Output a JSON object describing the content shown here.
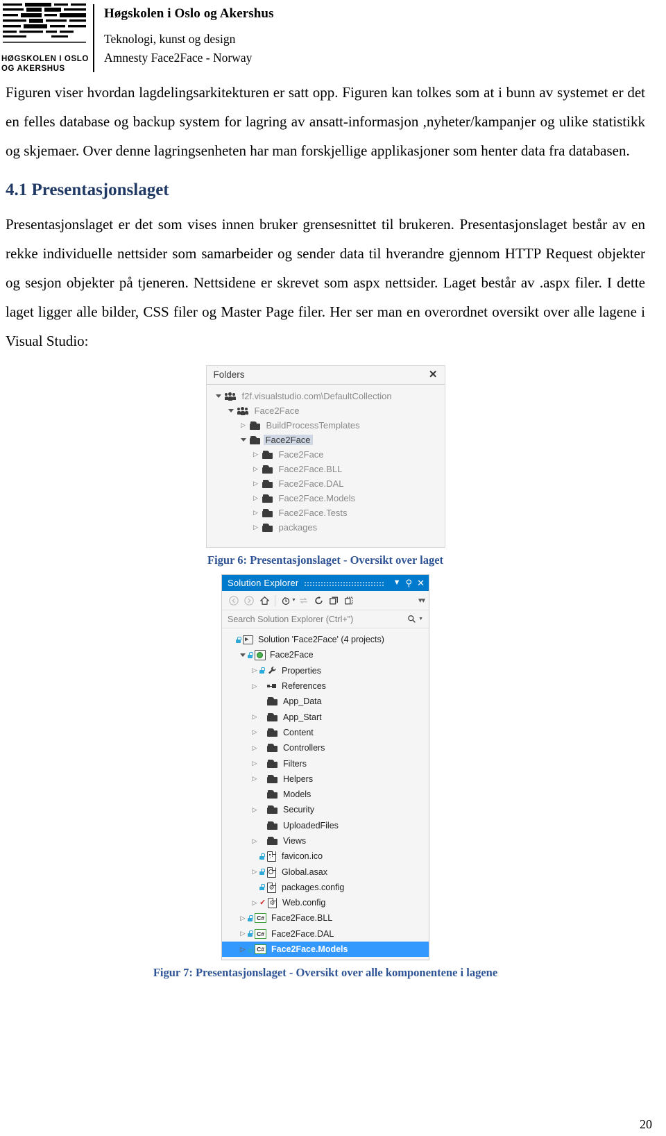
{
  "header": {
    "logo_caption_line1": "HØGSKOLEN I OSLO",
    "logo_caption_line2": "OG AKERSHUS",
    "org_name": "Høgskolen i Oslo og Akershus",
    "faculty": "Teknologi, kunst og design",
    "project": "Amnesty Face2Face - Norway"
  },
  "body": {
    "paragraph_1": "Figuren viser hvordan lagdelingsarkitekturen er satt opp. Figuren kan tolkes som at i bunn av systemet er det en felles database og backup system for lagring av ansatt-informasjon ,nyheter/kampanjer og ulike statistikk og skjemaer. Over denne lagringsenheten har man forskjellige applikasjoner som henter data fra databasen.",
    "heading_4_1": "4.1 Presentasjonslaget",
    "paragraph_2": "Presentasjonslaget er det som vises innen bruker grensesnittet til brukeren. Presentasjonslaget består av en rekke individuelle nettsider som samarbeider og sender data til hverandre gjennom HTTP Request objekter og sesjon objekter på tjeneren. Nettsidene er skrevet som aspx nettsider. Laget består av .aspx filer. I dette laget ligger alle bilder, CSS filer og Master Page filer. Her ser man en overordnet oversikt over alle lagene i Visual Studio:"
  },
  "figure6": {
    "caption": "Figur 6: Presentasjonslaget - Oversikt over laget",
    "panel_title": "Folders",
    "close_label": "✕",
    "tree": [
      {
        "label": "f2f.visualstudio.com\\DefaultCollection",
        "indent": 0,
        "expander": "down",
        "icon": "team-icon",
        "selected": false
      },
      {
        "label": "Face2Face",
        "indent": 1,
        "expander": "down",
        "icon": "team-icon",
        "selected": false
      },
      {
        "label": "BuildProcessTemplates",
        "indent": 2,
        "expander": "right",
        "icon": "folder-icon",
        "selected": false
      },
      {
        "label": "Face2Face",
        "indent": 2,
        "expander": "down",
        "icon": "folder-icon",
        "selected": true
      },
      {
        "label": "Face2Face",
        "indent": 3,
        "expander": "right",
        "icon": "folder-icon",
        "selected": false
      },
      {
        "label": "Face2Face.BLL",
        "indent": 3,
        "expander": "right",
        "icon": "folder-icon",
        "selected": false
      },
      {
        "label": "Face2Face.DAL",
        "indent": 3,
        "expander": "right",
        "icon": "folder-icon",
        "selected": false
      },
      {
        "label": "Face2Face.Models",
        "indent": 3,
        "expander": "right",
        "icon": "folder-icon",
        "selected": false
      },
      {
        "label": "Face2Face.Tests",
        "indent": 3,
        "expander": "right",
        "icon": "folder-icon",
        "selected": false
      },
      {
        "label": "packages",
        "indent": 3,
        "expander": "right",
        "icon": "folder-icon",
        "selected": false
      }
    ]
  },
  "figure7": {
    "caption": "Figur 7: Presentasjonslaget - Oversikt over alle komponentene i lagene",
    "panel_title": "Solution Explorer",
    "titlebar_buttons": [
      "dropdown-icon",
      "pin-icon",
      "close-icon"
    ],
    "toolbar_icons": [
      "back-arrow-icon",
      "forward-arrow-icon",
      "home-icon",
      "pending-changes-icon",
      "sync-icon",
      "refresh-icon",
      "collapse-all-icon",
      "show-all-files-icon"
    ],
    "search_placeholder": "Search Solution Explorer (Ctrl+\")",
    "search_value": "",
    "accent_color": "#007acc",
    "selection_color": "#3399ff",
    "tree": [
      {
        "label": "Solution 'Face2Face' (4 projects)",
        "indent": 0,
        "expander": "none",
        "badge": "lock",
        "icon": "solution-icon",
        "selected": false
      },
      {
        "label": "Face2Face",
        "indent": 1,
        "expander": "down",
        "badge": "lock",
        "icon": "web-project-icon",
        "selected": false
      },
      {
        "label": "Properties",
        "indent": 2,
        "expander": "right",
        "badge": "lock",
        "icon": "wrench-icon",
        "selected": false
      },
      {
        "label": "References",
        "indent": 2,
        "expander": "right",
        "badge": "none",
        "icon": "references-icon",
        "selected": false
      },
      {
        "label": "App_Data",
        "indent": 2,
        "expander": "none",
        "badge": "none",
        "icon": "folder-icon",
        "selected": false
      },
      {
        "label": "App_Start",
        "indent": 2,
        "expander": "right",
        "badge": "none",
        "icon": "folder-icon",
        "selected": false
      },
      {
        "label": "Content",
        "indent": 2,
        "expander": "right",
        "badge": "none",
        "icon": "folder-icon",
        "selected": false
      },
      {
        "label": "Controllers",
        "indent": 2,
        "expander": "right",
        "badge": "none",
        "icon": "folder-icon",
        "selected": false
      },
      {
        "label": "Filters",
        "indent": 2,
        "expander": "right",
        "badge": "none",
        "icon": "folder-icon",
        "selected": false
      },
      {
        "label": "Helpers",
        "indent": 2,
        "expander": "right",
        "badge": "none",
        "icon": "folder-icon",
        "selected": false
      },
      {
        "label": "Models",
        "indent": 2,
        "expander": "none",
        "badge": "none",
        "icon": "folder-icon",
        "selected": false
      },
      {
        "label": "Security",
        "indent": 2,
        "expander": "right",
        "badge": "none",
        "icon": "folder-icon",
        "selected": false
      },
      {
        "label": "UploadedFiles",
        "indent": 2,
        "expander": "none",
        "badge": "none",
        "icon": "folder-icon",
        "selected": false
      },
      {
        "label": "Views",
        "indent": 2,
        "expander": "right",
        "badge": "none",
        "icon": "folder-icon",
        "selected": false
      },
      {
        "label": "favicon.ico",
        "indent": 2,
        "expander": "none",
        "badge": "lock",
        "icon": "image-file-icon",
        "selected": false
      },
      {
        "label": "Global.asax",
        "indent": 2,
        "expander": "right",
        "badge": "lock",
        "icon": "gear-file-icon",
        "selected": false
      },
      {
        "label": "packages.config",
        "indent": 2,
        "expander": "none",
        "badge": "lock",
        "icon": "config-file-icon",
        "selected": false
      },
      {
        "label": "Web.config",
        "indent": 2,
        "expander": "right",
        "badge": "check",
        "icon": "config-file-icon",
        "selected": false
      },
      {
        "label": "Face2Face.BLL",
        "indent": 1,
        "expander": "right",
        "badge": "lock",
        "icon": "csharp-project-icon",
        "selected": false
      },
      {
        "label": "Face2Face.DAL",
        "indent": 1,
        "expander": "right",
        "badge": "lock",
        "icon": "csharp-project-icon",
        "selected": false
      },
      {
        "label": "Face2Face.Models",
        "indent": 1,
        "expander": "right",
        "badge": "lock",
        "icon": "csharp-project-icon",
        "selected": true
      }
    ]
  },
  "footer": {
    "page_number": "20"
  }
}
